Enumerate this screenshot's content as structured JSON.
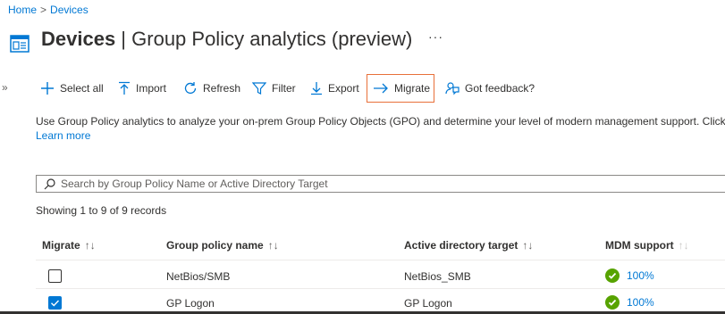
{
  "breadcrumb": {
    "home": "Home",
    "separator": ">",
    "current": "Devices"
  },
  "header": {
    "title_bold": "Devices",
    "title_sep": " | ",
    "title_rest": "Group Policy analytics (preview)",
    "more": "···"
  },
  "collapse_glyph": "»",
  "toolbar": {
    "select_all": "Select all",
    "import": "Import",
    "refresh": "Refresh",
    "filter": "Filter",
    "export": "Export",
    "migrate": "Migrate",
    "feedback": "Got feedback?"
  },
  "description": {
    "text": "Use Group Policy analytics to analyze your on-prem Group Policy Objects (GPO) and determine your level of modern management support. Click",
    "learn_more": "Learn more"
  },
  "search": {
    "placeholder": "Search by Group Policy Name or Active Directory Target"
  },
  "records_text": "Showing 1 to 9 of 9 records",
  "table": {
    "columns": [
      {
        "label": "Migrate",
        "sort": "↑↓"
      },
      {
        "label": "Group policy name",
        "sort": "↑↓"
      },
      {
        "label": "Active directory target",
        "sort": "↑↓"
      },
      {
        "label": "MDM support",
        "sort": "↑↓"
      }
    ],
    "rows": [
      {
        "checked": false,
        "name": "NetBios/SMB",
        "target": "NetBios_SMB",
        "mdm": "100%"
      },
      {
        "checked": true,
        "name": "GP Logon",
        "target": "GP Logon",
        "mdm": "100%"
      }
    ]
  },
  "colors": {
    "accent": "#0078d4",
    "migrate_highlight": "#e8703a",
    "success": "#57a300"
  }
}
